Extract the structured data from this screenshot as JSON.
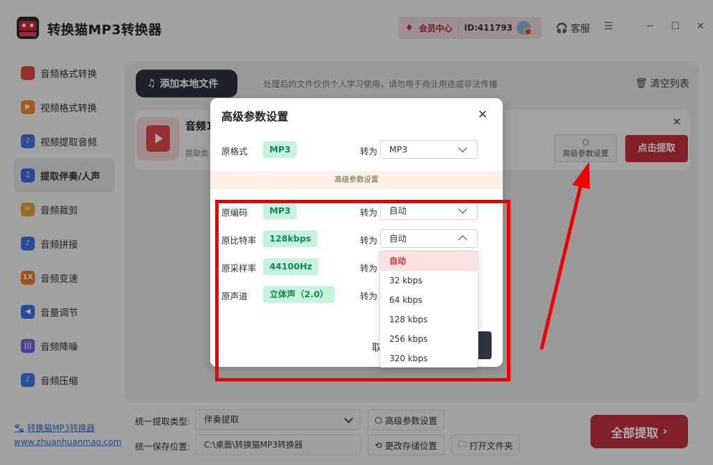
{
  "app": {
    "title": "转换猫MP3转换器"
  },
  "header": {
    "vip_label": "会员中心",
    "user_id": "ID:411793",
    "service_label": "客服",
    "menu_icon": "menu-icon",
    "minimize": "─",
    "maximize": "☐",
    "close": "✕"
  },
  "sidebar": {
    "items": [
      {
        "label": "音频格式转换",
        "color": "#e0483e"
      },
      {
        "label": "视频格式转换",
        "color": "#f08a2a"
      },
      {
        "label": "视频提取音频",
        "color": "#4a6fe0"
      },
      {
        "label": "提取伴奏/人声",
        "color": "#3b6ae0"
      },
      {
        "label": "音频裁剪",
        "color": "#e8a23a"
      },
      {
        "label": "音频拼接",
        "color": "#3e6fe0"
      },
      {
        "label": "音频变速",
        "color": "#f07a2a"
      },
      {
        "label": "音量调节",
        "color": "#3e72e0"
      },
      {
        "label": "音频降噪",
        "color": "#6f62e0"
      },
      {
        "label": "音频压缩",
        "color": "#3e7ae0"
      }
    ],
    "active_index": 3,
    "footer_name": "转换猫MP3转换器",
    "footer_url": "www.zhuanhuanmao.com"
  },
  "toolbar": {
    "add_label": "添加本地文件",
    "notice": "处理后的文件仅供个人学习使用，请勿用于商业用途或非法传播",
    "clear_label": "清空列表"
  },
  "file": {
    "name": "音频1",
    "sub": "提取类",
    "adv_label": "高级参数设置",
    "extract_label": "点击提取"
  },
  "bottom": {
    "type_label": "统一提取类型:",
    "type_value": "伴奏提取",
    "adv_label": "高级参数设置",
    "save_label": "统一保存位置:",
    "save_path": "C:\\桌面\\转换猫MP3转换器",
    "change_label": "更改存储位置",
    "open_label": "打开文件夹",
    "all_label": "全部提取"
  },
  "dialog": {
    "title": "高级参数设置",
    "to": "转为",
    "format": {
      "label": "原格式",
      "value": "MP3",
      "target": "MP3"
    },
    "banner": "高级参数设置",
    "codec": {
      "label": "原编码",
      "value": "MP3",
      "target": "自动"
    },
    "bitrate": {
      "label": "原比特率",
      "value": "128kbps",
      "target": "自动"
    },
    "samplerate": {
      "label": "原采样率",
      "value": "44100Hz"
    },
    "channels": {
      "label": "原声道",
      "value": "立体声（2.0）"
    },
    "cancel": "取"
  },
  "dropdown": {
    "options": [
      "自动",
      "32 kbps",
      "64 kbps",
      "128 kbps",
      "256 kbps",
      "320 kbps"
    ],
    "selected_index": 0
  },
  "annotation": {
    "color": "#f20000"
  }
}
